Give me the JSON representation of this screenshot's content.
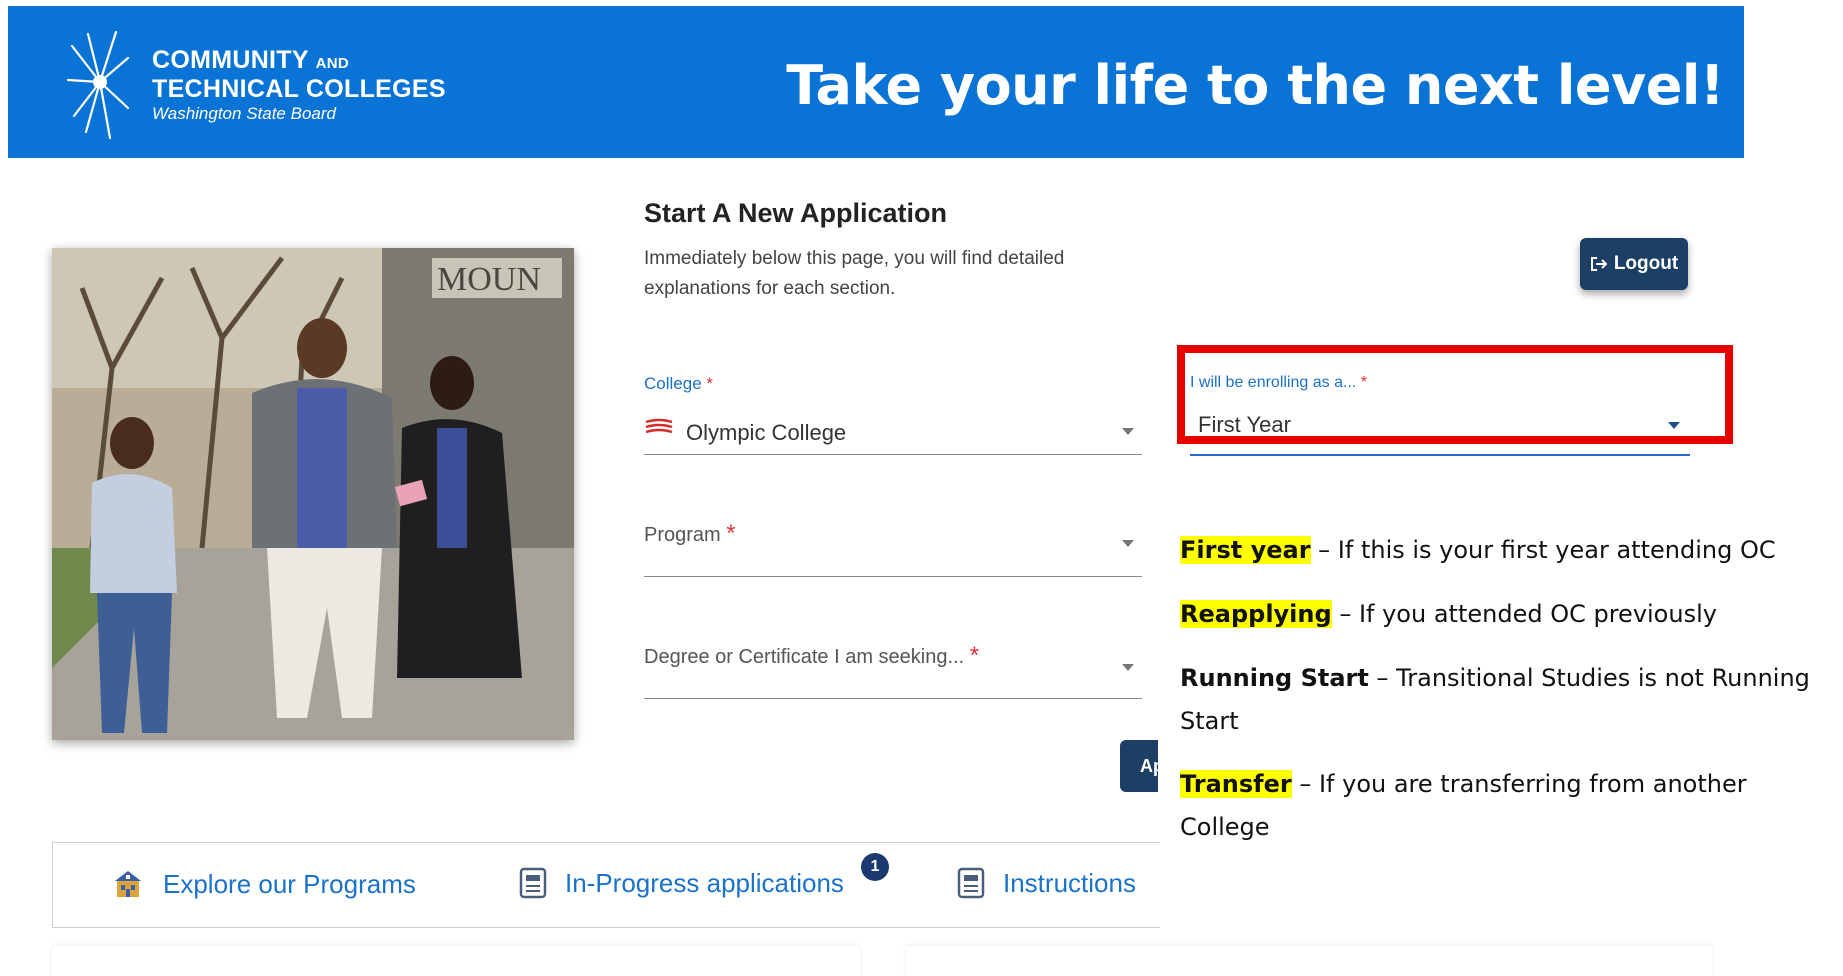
{
  "banner": {
    "logo_line1_main": "COMMUNITY",
    "logo_line1_small": "AND",
    "logo_line2": "TECHNICAL COLLEGES",
    "logo_line3": "Washington State Board",
    "tagline": "Take your life to the next level!",
    "background_color": "#0a73d6"
  },
  "form": {
    "title": "Start A New Application",
    "subtitle": "Immediately below this page, you will find detailed explanations for each section.",
    "college": {
      "label": "College",
      "required_mark": "*",
      "value": "Olympic College",
      "icon": "olympic-college-logo-icon"
    },
    "program": {
      "label": "Program",
      "required_mark": "*",
      "value": ""
    },
    "degree": {
      "label": "Degree or Certificate I am seeking...",
      "required_mark": "*",
      "value": ""
    },
    "enrolling": {
      "label": "I will be enrolling as a...",
      "required_mark": "*",
      "value": "First Year"
    },
    "apply_button_label": "Ap",
    "logout_label": "Logout",
    "logout_icon": "logout-icon"
  },
  "explanations": [
    {
      "term": "First year",
      "highlighted": true,
      "text": " – If this is your first year attending OC"
    },
    {
      "term": "Reapplying",
      "highlighted": true,
      "text": " – If you attended OC previously"
    },
    {
      "term": "Running Start",
      "highlighted": false,
      "text": " – Transitional Studies is not Running Start"
    },
    {
      "term": "Transfer",
      "highlighted": true,
      "text": " – If you are transferring from another College"
    }
  ],
  "bottom_nav": {
    "items": [
      {
        "label": "Explore our Programs",
        "icon": "school-building-icon"
      },
      {
        "label": "In-Progress applications",
        "icon": "document-icon",
        "badge": "1"
      },
      {
        "label": "Instructions",
        "icon": "document-icon"
      }
    ]
  },
  "colors": {
    "accent": "#1a72c9",
    "button": "#1c3f66",
    "required": "#e0333a",
    "highlight_border": "#e60000",
    "marker": "#ffff00"
  }
}
